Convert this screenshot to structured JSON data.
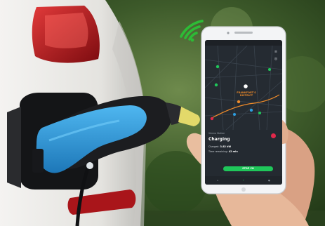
{
  "scene": {
    "colors": {
      "sky": "#2f4a22",
      "car_body": "#ecebe8",
      "tail_light": "#b3161d",
      "plug_blue": "#2d9ee0",
      "plug_black": "#1c1d20",
      "plug_tip": "#e3d96a",
      "wifi": "#2dbb36",
      "skin": "#e7b89a"
    },
    "icons": [
      "wifi-icon",
      "charging-plug",
      "smartphone"
    ]
  },
  "phone": {
    "status": {
      "left": "",
      "right": ""
    },
    "map": {
      "station_label": "FRANKFORT'S DISTRICT",
      "station_sublabel": ""
    },
    "sheet": {
      "caption": "Vienna Station",
      "title": "Charging",
      "row1_label": "Charged:",
      "row1_value": "3.82 kW",
      "row2_label": "Time remaining:",
      "row2_value": "42 min",
      "button": "STOP CH"
    },
    "tabs": [
      "",
      "",
      ""
    ]
  }
}
